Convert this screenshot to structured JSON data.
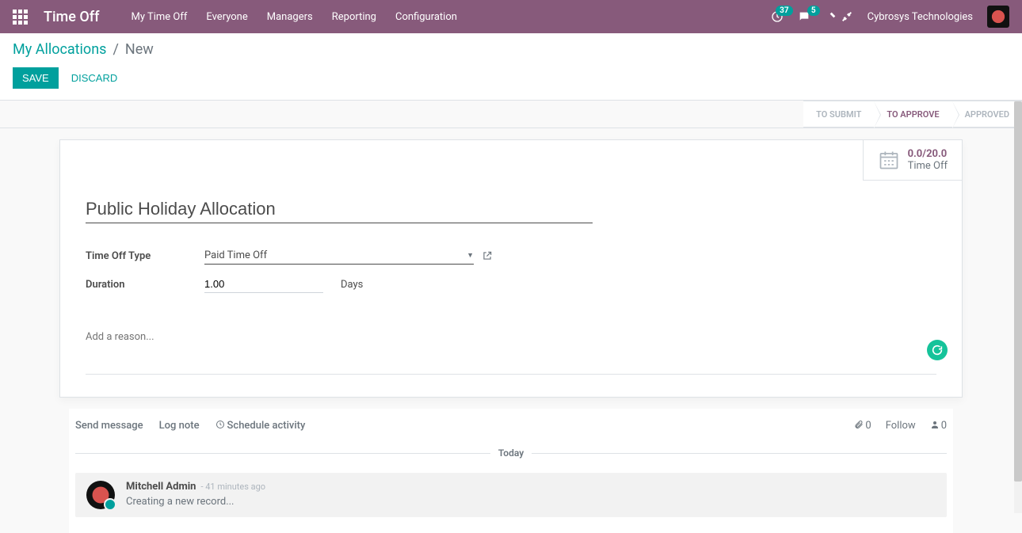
{
  "header": {
    "brand": "Time Off",
    "nav": [
      "My Time Off",
      "Everyone",
      "Managers",
      "Reporting",
      "Configuration"
    ],
    "activity_count": "37",
    "message_count": "5",
    "company": "Cybrosys Technologies"
  },
  "breadcrumb": {
    "link": "My Allocations",
    "current": "New"
  },
  "buttons": {
    "save": "SAVE",
    "discard": "DISCARD"
  },
  "status": {
    "to_submit": "TO SUBMIT",
    "to_approve": "TO APPROVE",
    "approved": "APPROVED"
  },
  "stat": {
    "count": "0.0/20.0",
    "label": "Time Off"
  },
  "form": {
    "title": "Public Holiday Allocation",
    "type_label": "Time Off Type",
    "type_value": "Paid Time Off",
    "duration_label": "Duration",
    "duration_value": "1.00",
    "duration_unit": "Days",
    "reason_placeholder": "Add a reason..."
  },
  "chatter": {
    "send": "Send message",
    "log": "Log note",
    "schedule": "Schedule activity",
    "attach_count": "0",
    "follow": "Follow",
    "follower_count": "0",
    "today": "Today",
    "message": {
      "author": "Mitchell Admin",
      "time": "- 41 minutes ago",
      "body": "Creating a new record..."
    }
  }
}
